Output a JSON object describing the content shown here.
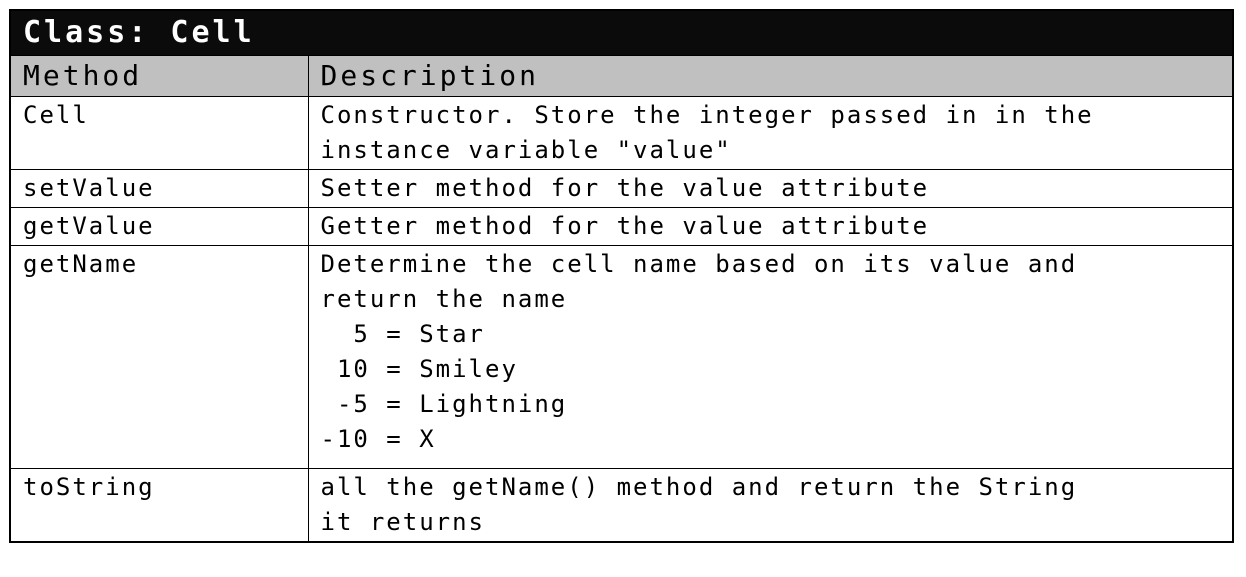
{
  "table": {
    "title": "Class: Cell",
    "headers": {
      "method": "Method",
      "description": "Description"
    },
    "rows": [
      {
        "method": "Cell",
        "description": [
          "Constructor. Store the integer passed in in the",
          "instance variable \"value\""
        ]
      },
      {
        "method": "setValue",
        "description": [
          "Setter method for the value attribute"
        ]
      },
      {
        "method": "getValue",
        "description": [
          "Getter method for the value attribute"
        ]
      },
      {
        "method": "getName",
        "description": [
          "Determine the cell name based on its value and",
          "return the name",
          "  5 = Star",
          " 10 = Smiley",
          " -5 = Lightning",
          "-10 = X"
        ]
      },
      {
        "method": "toString",
        "description": [
          "all the getName() method and return the String",
          "it returns"
        ]
      }
    ]
  }
}
